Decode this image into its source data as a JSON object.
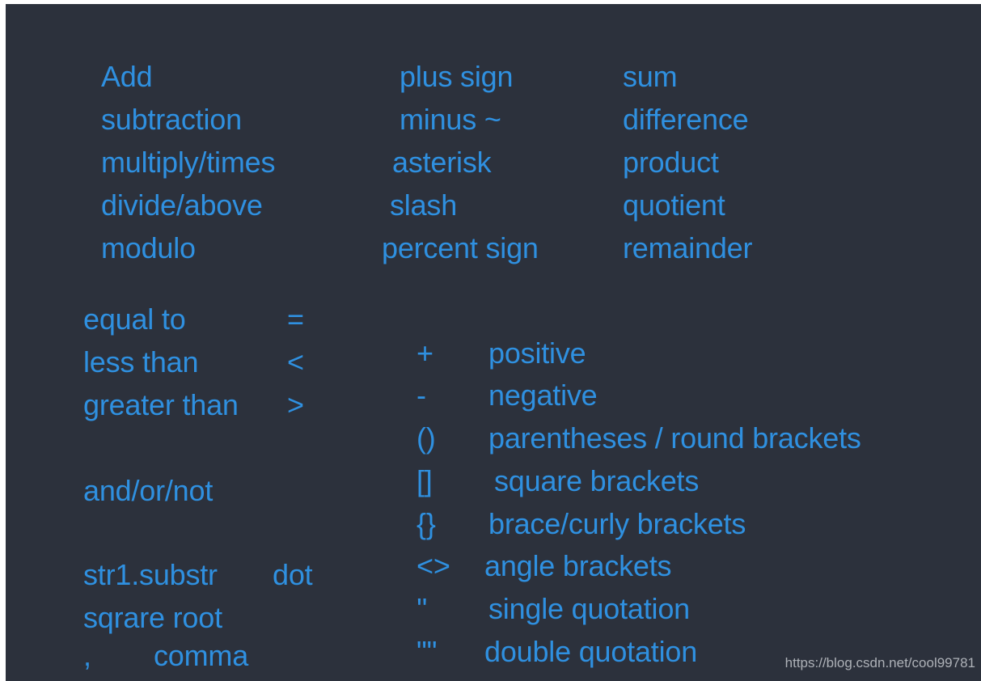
{
  "background_color": "#2c313c",
  "text_color": "#2f90e0",
  "watermark_color": "#b9bcc2",
  "arithmetic": {
    "rows": [
      {
        "operation": "Add",
        "symbol_name": "plus sign",
        "result_name": "sum"
      },
      {
        "operation": "subtraction",
        "symbol_name": "minus ~",
        "result_name": "difference"
      },
      {
        "operation": "multiply/times",
        "symbol_name": "asterisk",
        "result_name": "product"
      },
      {
        "operation": "divide/above",
        "symbol_name": "slash",
        "result_name": "quotient"
      },
      {
        "operation": "modulo",
        "symbol_name": "percent sign",
        "result_name": "remainder"
      }
    ]
  },
  "comparison": {
    "rows": [
      {
        "label": "equal to",
        "symbol": "="
      },
      {
        "label": "less than",
        "symbol": "<"
      },
      {
        "label": "greater than",
        "symbol": ">"
      }
    ]
  },
  "logical": {
    "label": "and/or/not"
  },
  "misc": {
    "rows": [
      {
        "label": "str1.substr",
        "symbol": "dot"
      },
      {
        "label": "sqrare root",
        "symbol": ""
      },
      {
        "label": ",",
        "symbol": "comma"
      }
    ]
  },
  "symbols": {
    "rows": [
      {
        "glyph": "+",
        "name": "positive"
      },
      {
        "glyph": "-",
        "name": "negative"
      },
      {
        "glyph": "()",
        "name": "parentheses / round brackets"
      },
      {
        "glyph": "[]",
        "name": "square brackets"
      },
      {
        "glyph": "{}",
        "name": "brace/curly brackets"
      },
      {
        "glyph": "<>",
        "name": "angle brackets"
      },
      {
        "glyph": "''",
        "name": "single quotation"
      },
      {
        "glyph": "\"\"",
        "name": "double quotation"
      }
    ]
  },
  "watermark": {
    "url": "https://blog.csdn.net/cool99781"
  }
}
